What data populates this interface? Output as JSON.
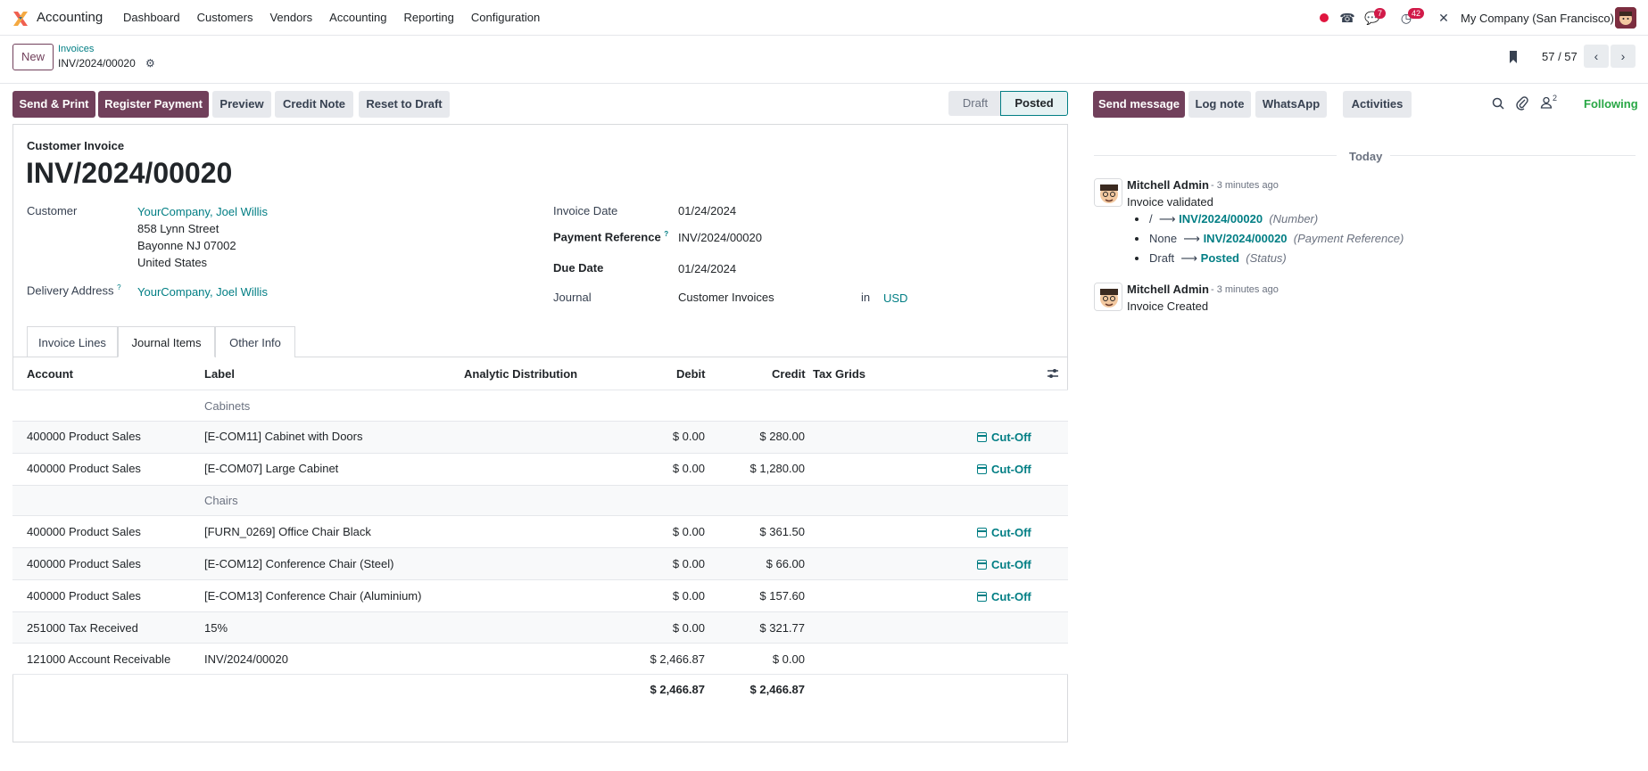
{
  "navbar": {
    "app_name": "Accounting",
    "menu": [
      "Dashboard",
      "Customers",
      "Vendors",
      "Accounting",
      "Reporting",
      "Configuration"
    ],
    "messages_badge": "7",
    "activities_badge": "42",
    "company": "My Company (San Francisco)"
  },
  "control": {
    "new_label": "New",
    "breadcrumb_parent": "Invoices",
    "breadcrumb_current": "INV/2024/00020",
    "pager": "57 / 57"
  },
  "actions": {
    "send_print": "Send & Print",
    "register_payment": "Register Payment",
    "preview": "Preview",
    "credit_note": "Credit Note",
    "reset_draft": "Reset to Draft"
  },
  "status": {
    "draft": "Draft",
    "posted": "Posted"
  },
  "form": {
    "doc_type": "Customer Invoice",
    "title": "INV/2024/00020",
    "customer_label": "Customer",
    "customer_name": "YourCompany, Joel Willis",
    "address1": "858 Lynn Street",
    "address2": "Bayonne NJ 07002",
    "address3": "United States",
    "delivery_label": "Delivery Address",
    "delivery_value": "YourCompany, Joel Willis",
    "invoice_date_label": "Invoice Date",
    "invoice_date": "01/24/2024",
    "payment_ref_label": "Payment Reference",
    "payment_ref": "INV/2024/00020",
    "due_date_label": "Due Date",
    "due_date": "01/24/2024",
    "journal_label": "Journal",
    "journal": "Customer Invoices",
    "in_label": "in",
    "currency": "USD",
    "tooltip_mark": "?"
  },
  "tabs": [
    "Invoice Lines",
    "Journal Items",
    "Other Info"
  ],
  "table": {
    "headers": [
      "Account",
      "Label",
      "Analytic Distribution",
      "Debit",
      "Credit",
      "Tax Grids"
    ],
    "sections": [
      "Cabinets",
      "Chairs"
    ],
    "rows": [
      {
        "account": "400000 Product Sales",
        "label": "[E-COM11] Cabinet with Doors",
        "debit": "$ 0.00",
        "credit": "$ 280.00",
        "tag": "Cut-Off"
      },
      {
        "account": "400000 Product Sales",
        "label": "[E-COM07] Large Cabinet",
        "debit": "$ 0.00",
        "credit": "$ 1,280.00",
        "tag": "Cut-Off"
      },
      {
        "account": "400000 Product Sales",
        "label": "[FURN_0269] Office Chair Black",
        "debit": "$ 0.00",
        "credit": "$ 361.50",
        "tag": "Cut-Off"
      },
      {
        "account": "400000 Product Sales",
        "label": "[E-COM12] Conference Chair (Steel)",
        "debit": "$ 0.00",
        "credit": "$ 66.00",
        "tag": "Cut-Off"
      },
      {
        "account": "400000 Product Sales",
        "label": "[E-COM13] Conference Chair (Aluminium)",
        "debit": "$ 0.00",
        "credit": "$ 157.60",
        "tag": "Cut-Off"
      },
      {
        "account": "251000 Tax Received",
        "label": "15%",
        "debit": "$ 0.00",
        "credit": "$ 321.77",
        "tag": ""
      },
      {
        "account": "121000 Account Receivable",
        "label": "INV/2024/00020",
        "debit": "$ 2,466.87",
        "credit": "$ 0.00",
        "tag": ""
      }
    ],
    "total_debit": "$ 2,466.87",
    "total_credit": "$ 2,466.87"
  },
  "chatter": {
    "send_message": "Send message",
    "log_note": "Log note",
    "whatsapp": "WhatsApp",
    "activities": "Activities",
    "followers_count": "2",
    "following": "Following",
    "today": "Today",
    "messages": [
      {
        "author": "Mitchell Admin",
        "ago": "- 3 minutes ago",
        "body": "Invoice validated",
        "tracking": [
          {
            "old": "/",
            "new": "INV/2024/00020",
            "field": "(Number)"
          },
          {
            "old": "None",
            "new": "INV/2024/00020",
            "field": "(Payment Reference)"
          },
          {
            "old": "Draft",
            "new": "Posted",
            "field": "(Status)"
          }
        ]
      },
      {
        "author": "Mitchell Admin",
        "ago": "- 3 minutes ago",
        "body": "Invoice Created"
      }
    ]
  },
  "colors": {
    "brand": "#71405b",
    "link": "#017e84",
    "following": "#28a745",
    "badge": "#d11a49"
  }
}
